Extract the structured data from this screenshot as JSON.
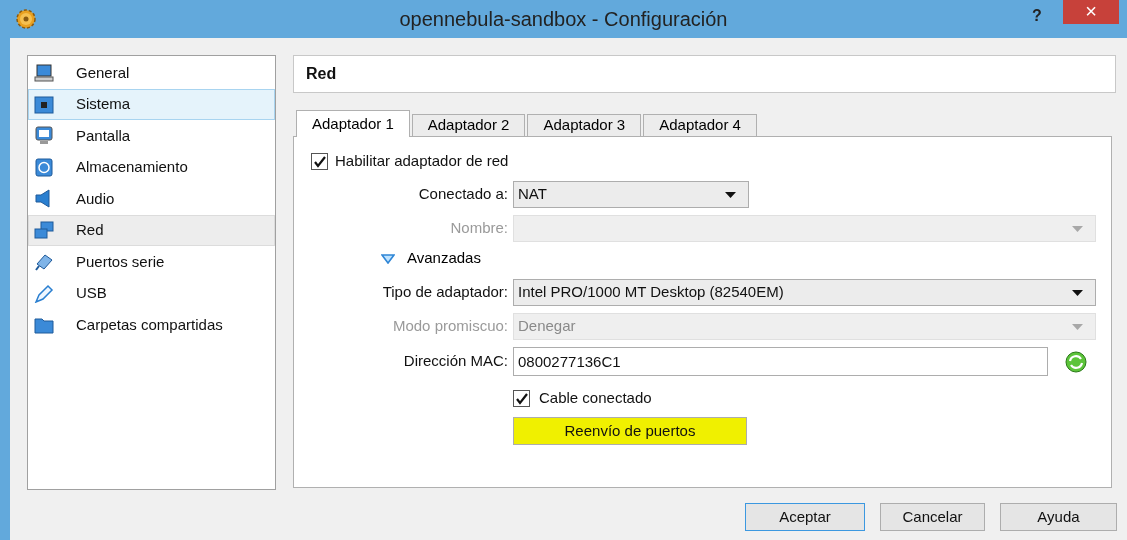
{
  "window": {
    "title": "opennebula-sandbox - Configuración",
    "help": "?",
    "close": "×"
  },
  "sidebar": {
    "items": [
      {
        "label": "General",
        "selected": false,
        "highlighted": false
      },
      {
        "label": "Sistema",
        "selected": false,
        "highlighted": true
      },
      {
        "label": "Pantalla",
        "selected": false,
        "highlighted": false
      },
      {
        "label": "Almacenamiento",
        "selected": false,
        "highlighted": false
      },
      {
        "label": "Audio",
        "selected": false,
        "highlighted": false
      },
      {
        "label": "Red",
        "selected": true,
        "highlighted": false
      },
      {
        "label": "Puertos serie",
        "selected": false,
        "highlighted": false
      },
      {
        "label": "USB",
        "selected": false,
        "highlighted": false
      },
      {
        "label": "Carpetas compartidas",
        "selected": false,
        "highlighted": false
      }
    ]
  },
  "section_title": "Red",
  "tabs": [
    {
      "label": "Adaptador 1",
      "selected": true
    },
    {
      "label": "Adaptador 2",
      "selected": false
    },
    {
      "label": "Adaptador 3",
      "selected": false
    },
    {
      "label": "Adaptador 4",
      "selected": false
    }
  ],
  "enable_adapter": {
    "label": "Habilitar adaptador de red",
    "checked": true
  },
  "fields": [
    {
      "kind": "combo",
      "label": "Conectado a:",
      "value": "NAT",
      "disabled": false
    },
    {
      "kind": "combo",
      "label": "Nombre:",
      "disabled": true
    },
    {
      "kind": "expander",
      "label": "Avanzadas",
      "expanded": true
    },
    {
      "kind": "combo",
      "label": "Tipo de adaptador:",
      "value": "Intel PRO/1000 MT Desktop (82540EM)",
      "disabled": false
    },
    {
      "kind": "combo",
      "label": "Modo promiscuo:",
      "value": "Denegar",
      "disabled": true
    },
    {
      "kind": "text",
      "label": "Dirección MAC:",
      "value": "0800277136C1"
    },
    {
      "kind": "checkbox",
      "label": "Cable conectado",
      "checked": true
    },
    {
      "kind": "button",
      "label": "Reenvío de puertos",
      "highlighted": true
    }
  ],
  "buttons": [
    {
      "label": "Aceptar",
      "default": true
    },
    {
      "label": "Cancelar",
      "default": false
    },
    {
      "label": "Ayuda",
      "default": false
    }
  ]
}
